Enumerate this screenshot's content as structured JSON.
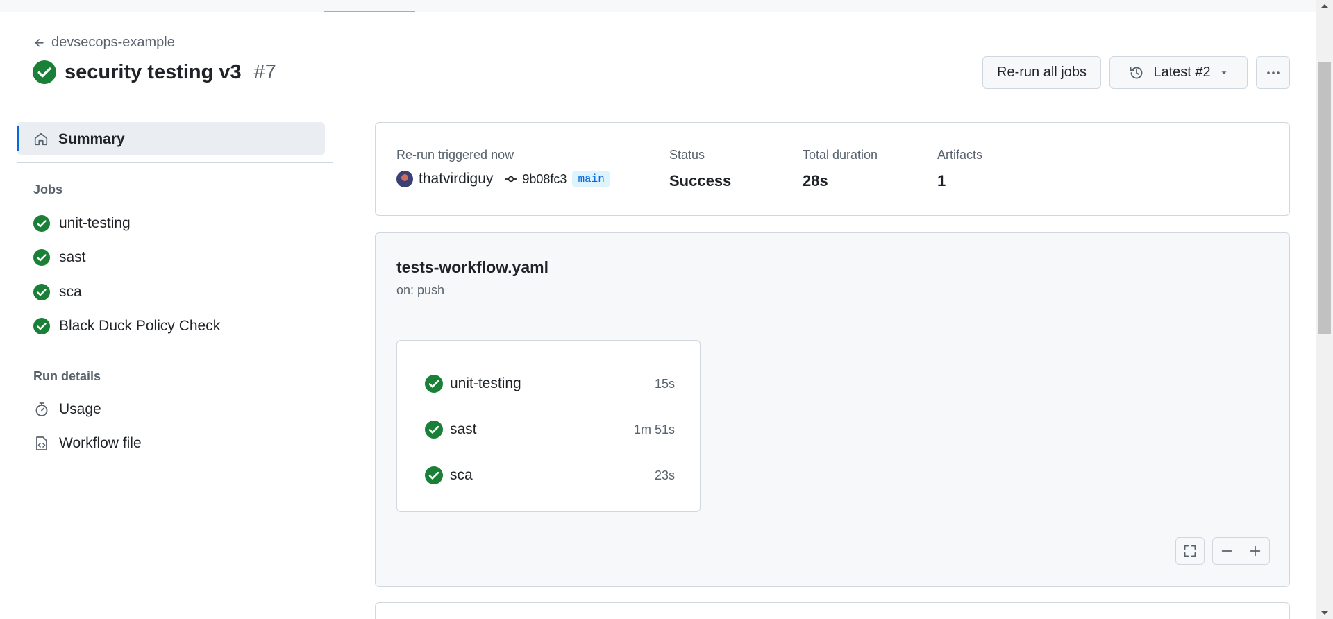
{
  "header": {
    "back_label": "devsecops-example",
    "title": "security testing v3",
    "run_number": "#7"
  },
  "actions": {
    "rerun_label": "Re-run all jobs",
    "latest_label": "Latest #2"
  },
  "sidebar": {
    "summary_label": "Summary",
    "jobs_heading": "Jobs",
    "jobs": [
      {
        "label": "unit-testing",
        "status": "success"
      },
      {
        "label": "sast",
        "status": "success"
      },
      {
        "label": "sca",
        "status": "success"
      },
      {
        "label": "Black Duck Policy Check",
        "status": "success"
      }
    ],
    "run_details_heading": "Run details",
    "details": [
      {
        "label": "Usage",
        "icon": "stopwatch-icon"
      },
      {
        "label": "Workflow file",
        "icon": "file-code-icon"
      }
    ]
  },
  "summary": {
    "trigger_label": "Re-run triggered now",
    "user": "thatvirdiguy",
    "commit": "9b08fc3",
    "branch": "main",
    "status_label": "Status",
    "status_value": "Success",
    "duration_label": "Total duration",
    "duration_value": "28s",
    "artifacts_label": "Artifacts",
    "artifacts_value": "1"
  },
  "workflow": {
    "file": "tests-workflow.yaml",
    "trigger": "on: push",
    "jobs": [
      {
        "name": "unit-testing",
        "time": "15s"
      },
      {
        "name": "sast",
        "time": "1m 51s"
      },
      {
        "name": "sca",
        "time": "23s"
      }
    ]
  },
  "colors": {
    "success": "#1a7f37",
    "accent": "#0969da",
    "tab_underline": "#fd8c73"
  }
}
